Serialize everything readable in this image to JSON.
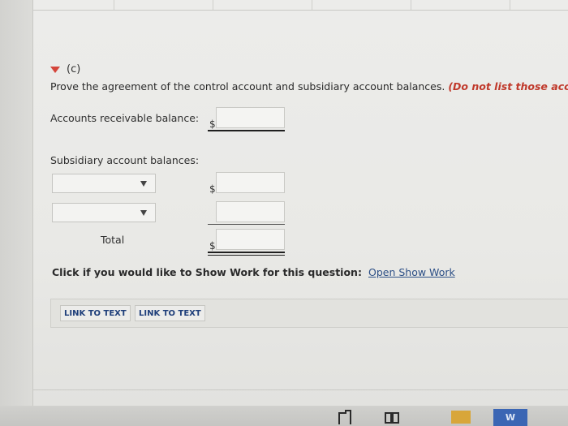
{
  "section": {
    "part_label": "(c)"
  },
  "prompt": {
    "text": "Prove the agreement of the control account and subsidiary account balances. ",
    "note": "(Do not list those accou"
  },
  "ar": {
    "label": "Accounts receivable balance:",
    "currency": "$",
    "value": ""
  },
  "subsidiary": {
    "label": "Subsidiary account balances:",
    "rows": [
      {
        "selected": "",
        "currency": "$",
        "value": ""
      },
      {
        "selected": "",
        "currency": "",
        "value": ""
      }
    ]
  },
  "total": {
    "label": "Total",
    "currency": "$",
    "value": ""
  },
  "show_work": {
    "prompt": "Click if you would like to Show Work for this question:",
    "link": "Open Show Work"
  },
  "link_to_text": [
    "LINK TO TEXT",
    "LINK TO TEXT"
  ],
  "taskbar": {
    "word_letter": "W"
  }
}
